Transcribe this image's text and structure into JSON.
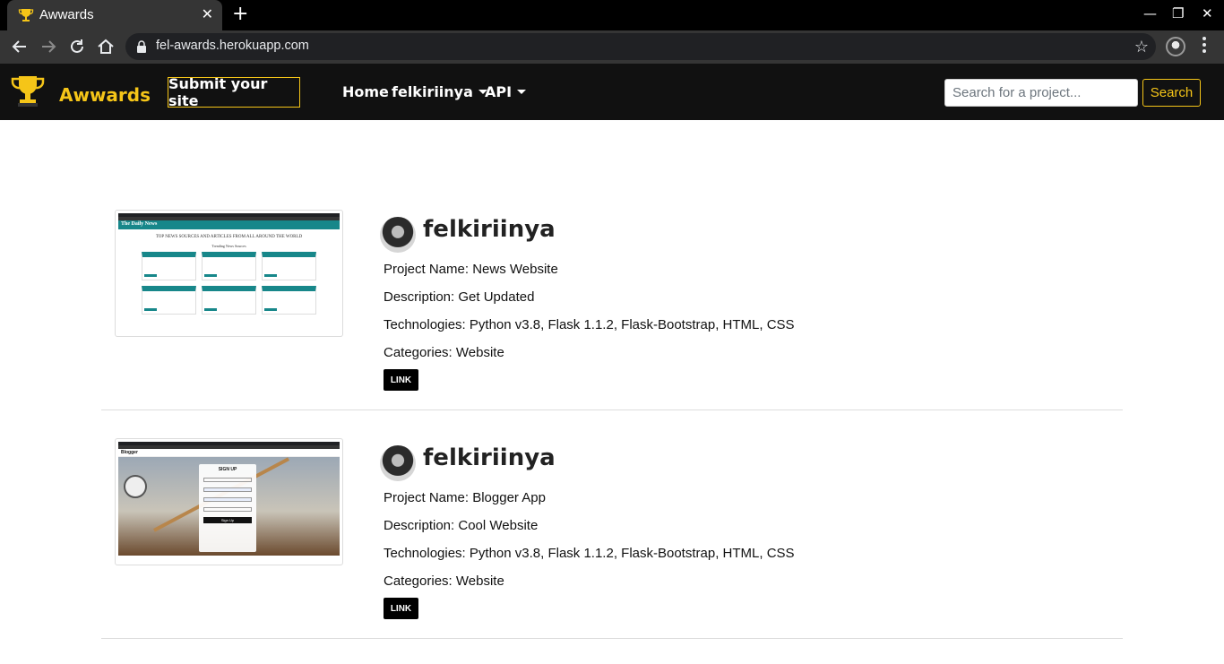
{
  "browser": {
    "tab_title": "Awwards",
    "url": "fel-awards.herokuapp.com"
  },
  "navbar": {
    "brand": "Awwards",
    "submit_label": "Submit your site",
    "links": [
      "Home",
      "felkiriinya",
      "API"
    ],
    "search_placeholder": "Search for a project...",
    "search_button": "Search",
    "accent_color": "#f5c518"
  },
  "projects": [
    {
      "username": "felkiriinya",
      "name": "Project Name: News Website",
      "description": "Description: Get Updated",
      "technologies": "Technologies: Python v3.8, Flask 1.1.2, Flask-Bootstrap, HTML, CSS",
      "categories": "Categories: Website",
      "link_label": "LINK",
      "thumbnail": {
        "header": "The Daily News",
        "heading": "TOP NEWS SOURCES AND ARTICLES FROM ALL AROUND THE WORLD",
        "subheading": "Trending News Sources"
      }
    },
    {
      "username": "felkiriinya",
      "name": "Project Name: Blogger App",
      "description": "Description: Cool Website",
      "technologies": "Technologies: Python v3.8, Flask 1.1.2, Flask-Bootstrap, HTML, CSS",
      "categories": "Categories: Website",
      "link_label": "LINK",
      "thumbnail": {
        "brand": "Blogger",
        "form_title": "SIGN UP",
        "button": "Sign Up"
      }
    }
  ]
}
